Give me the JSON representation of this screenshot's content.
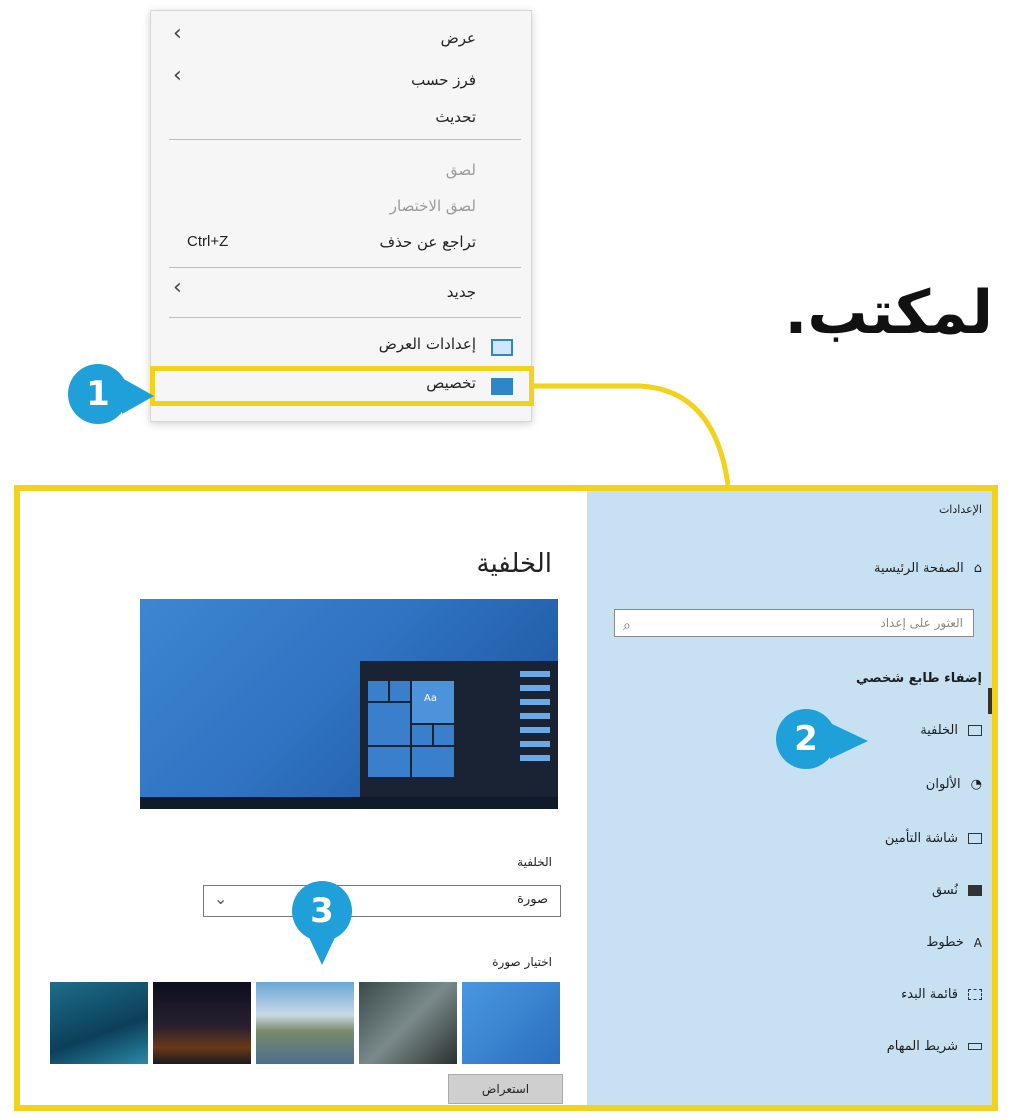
{
  "heading": "لمكتب.",
  "context_menu": {
    "items": [
      {
        "label": "عرض",
        "submenu": true
      },
      {
        "label": "فرز حسب",
        "submenu": true
      },
      {
        "label": "تحديث"
      },
      {
        "label": "لصق",
        "disabled": true
      },
      {
        "label": "لصق الاختصار",
        "disabled": true
      },
      {
        "label": "تراجع عن حذف",
        "shortcut": "Ctrl+Z"
      },
      {
        "label": "جديد",
        "submenu": true
      },
      {
        "label": "إعدادات العرض",
        "icon": "display-icon"
      },
      {
        "label": "تخصيص",
        "icon": "personalize-icon"
      }
    ]
  },
  "callouts": [
    "1",
    "2",
    "3"
  ],
  "settings": {
    "window_title": "الإعدادات",
    "sidebar": {
      "home": "الصفحة الرئيسية",
      "search_placeholder": "العثور على إعداد",
      "section": "إضفاء طابع شخصي",
      "items": [
        {
          "label": "الخلفية",
          "icon": "picture-icon"
        },
        {
          "label": "الألوان",
          "icon": "palette-icon"
        },
        {
          "label": "شاشة التأمين",
          "icon": "lock-screen-icon"
        },
        {
          "label": "نُسق",
          "icon": "themes-icon"
        },
        {
          "label": "خطوط",
          "icon": "fonts-icon"
        },
        {
          "label": "قائمة البدء",
          "icon": "start-icon"
        },
        {
          "label": "شريط المهام",
          "icon": "taskbar-icon"
        }
      ]
    },
    "main": {
      "title": "الخلفية",
      "preview_tile_text": "Aa",
      "background_label": "الخلفية",
      "background_value": "صورة",
      "choose_picture_label": "اختيار صورة",
      "browse_button": "استعراض"
    },
    "colors": {
      "accent": "#1fa0d8",
      "highlight": "#f2d21a",
      "sidebar": "#c7e1f3"
    }
  }
}
